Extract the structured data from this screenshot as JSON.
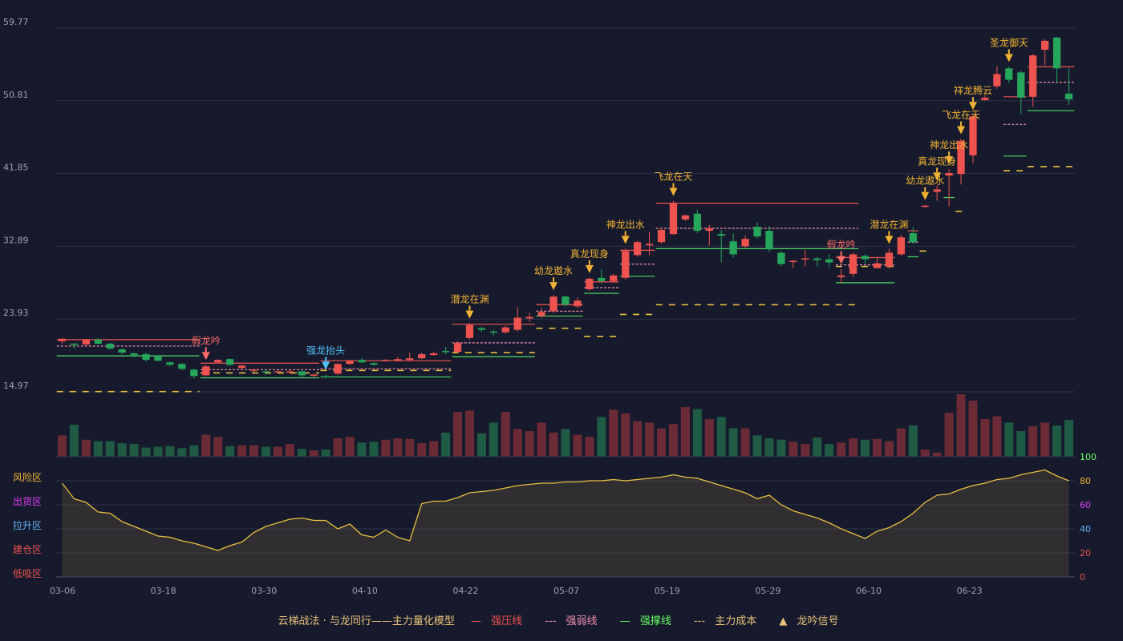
{
  "chart_data": {
    "type": "candlestick",
    "x_ticks": [
      "03-06",
      "03-18",
      "03-30",
      "04-10",
      "04-22",
      "05-07",
      "05-19",
      "05-29",
      "06-10",
      "06-23"
    ],
    "y_ticks": [
      "14.97",
      "23.93",
      "32.89",
      "41.85",
      "50.81",
      "59.77"
    ],
    "ylim": [
      14.97,
      59.77
    ],
    "candles": [
      [
        21.2,
        21.5,
        20.9,
        21.6
      ],
      [
        20.9,
        20.8,
        20.3,
        21.0
      ],
      [
        20.8,
        21.4,
        20.7,
        21.5
      ],
      [
        21.4,
        20.9,
        20.8,
        21.6
      ],
      [
        20.9,
        20.3,
        20.1,
        21.0
      ],
      [
        20.2,
        19.8,
        19.6,
        20.3
      ],
      [
        19.7,
        19.5,
        19.2,
        19.8
      ],
      [
        19.6,
        18.9,
        18.7,
        19.8
      ],
      [
        19.3,
        18.8,
        18.7,
        19.4
      ],
      [
        18.6,
        18.3,
        18.1,
        18.7
      ],
      [
        18.4,
        17.8,
        17.6,
        18.5
      ],
      [
        17.7,
        16.9,
        16.6,
        17.8
      ],
      [
        17.0,
        18.1,
        16.9,
        18.3
      ],
      [
        18.6,
        18.9,
        18.5,
        19.0
      ],
      [
        19.0,
        18.3,
        18.1,
        19.1
      ],
      [
        17.9,
        18.2,
        17.7,
        18.3
      ],
      [
        17.6,
        17.7,
        17.4,
        17.8
      ],
      [
        17.5,
        17.4,
        17.1,
        17.6
      ],
      [
        17.5,
        17.5,
        17.3,
        17.6
      ],
      [
        17.5,
        17.5,
        17.2,
        17.7
      ],
      [
        17.5,
        17.0,
        16.8,
        17.6
      ],
      [
        17.0,
        17.1,
        16.8,
        17.2
      ],
      [
        16.9,
        16.8,
        16.6,
        17.1
      ],
      [
        17.2,
        18.4,
        17.1,
        18.5
      ],
      [
        18.4,
        18.8,
        18.3,
        18.9
      ],
      [
        18.9,
        18.6,
        18.5,
        19.1
      ],
      [
        18.5,
        18.3,
        18.2,
        18.6
      ],
      [
        18.8,
        18.9,
        18.7,
        19.0
      ],
      [
        18.8,
        19.0,
        18.7,
        19.3
      ],
      [
        18.9,
        19.1,
        18.7,
        19.8
      ],
      [
        19.1,
        19.6,
        19.0,
        19.8
      ],
      [
        19.5,
        19.7,
        19.4,
        19.9
      ],
      [
        20.0,
        19.9,
        19.6,
        20.5
      ],
      [
        19.9,
        21.0,
        19.8,
        21.2
      ],
      [
        21.6,
        23.2,
        21.4,
        23.4
      ],
      [
        22.8,
        22.6,
        22.3,
        23.0
      ],
      [
        22.4,
        22.3,
        21.9,
        22.6
      ],
      [
        22.3,
        22.9,
        22.1,
        23.1
      ],
      [
        22.6,
        24.1,
        22.4,
        25.4
      ],
      [
        24.0,
        24.2,
        23.6,
        24.7
      ],
      [
        24.3,
        24.8,
        24.1,
        25.3
      ],
      [
        24.9,
        26.7,
        24.7,
        26.9
      ],
      [
        26.7,
        25.7,
        25.5,
        26.8
      ],
      [
        25.5,
        26.2,
        25.3,
        26.6
      ],
      [
        27.6,
        28.9,
        27.4,
        29.0
      ],
      [
        29.0,
        28.6,
        28.3,
        30.1
      ],
      [
        28.6,
        29.3,
        28.5,
        29.5
      ],
      [
        29.0,
        32.3,
        28.8,
        32.6
      ],
      [
        31.8,
        33.4,
        31.6,
        33.6
      ],
      [
        33.0,
        33.2,
        31.8,
        34.7
      ],
      [
        33.4,
        34.9,
        33.2,
        35.1
      ],
      [
        34.4,
        38.2,
        34.3,
        38.5
      ],
      [
        36.2,
        36.7,
        36.0,
        36.8
      ],
      [
        36.9,
        34.8,
        34.5,
        37.4
      ],
      [
        34.8,
        35.1,
        33.0,
        35.5
      ],
      [
        34.4,
        34.2,
        30.9,
        34.9
      ],
      [
        33.5,
        31.9,
        31.5,
        34.5
      ],
      [
        32.9,
        33.8,
        32.7,
        34.2
      ],
      [
        35.3,
        34.1,
        33.9,
        35.8
      ],
      [
        34.8,
        32.5,
        32.2,
        35.4
      ],
      [
        32.1,
        30.7,
        30.4,
        32.3
      ],
      [
        31.0,
        31.1,
        30.2,
        31.2
      ],
      [
        31.3,
        31.4,
        30.4,
        32.4
      ],
      [
        31.4,
        31.2,
        30.4,
        31.6
      ],
      [
        31.3,
        30.9,
        30.3,
        31.9
      ],
      [
        29.1,
        29.3,
        28.3,
        30.1
      ],
      [
        29.5,
        31.9,
        29.1,
        32.1
      ],
      [
        31.7,
        31.3,
        30.7,
        31.9
      ],
      [
        30.2,
        30.8,
        30.2,
        31.4
      ],
      [
        30.4,
        32.1,
        30.1,
        32.6
      ],
      [
        31.9,
        34.0,
        31.7,
        34.3
      ],
      [
        34.5,
        33.4,
        33.2,
        35.3
      ],
      [
        37.8,
        37.9,
        37.6,
        38.0
      ],
      [
        39.6,
        39.9,
        38.5,
        40.4
      ],
      [
        41.6,
        41.9,
        37.8,
        42.4
      ],
      [
        41.8,
        45.9,
        40.5,
        46.1
      ],
      [
        44.1,
        48.9,
        43.1,
        49.1
      ],
      [
        50.9,
        51.2,
        50.8,
        51.5
      ],
      [
        52.6,
        54.1,
        52.3,
        55.1
      ],
      [
        54.8,
        53.4,
        53.0,
        55.0
      ],
      [
        54.3,
        51.2,
        49.2,
        54.5
      ],
      [
        51.3,
        56.4,
        50.1,
        56.6
      ],
      [
        57.1,
        58.2,
        55.2,
        58.4
      ],
      [
        58.6,
        54.8,
        53.1,
        58.7
      ],
      [
        51.7,
        51.0,
        50.3,
        54.8
      ]
    ],
    "volumes": [
      30,
      45,
      24,
      22,
      22,
      19,
      18,
      13,
      14,
      15,
      12,
      16,
      31,
      28,
      15,
      16,
      16,
      14,
      14,
      18,
      11,
      9,
      10,
      26,
      28,
      20,
      21,
      24,
      26,
      25,
      19,
      22,
      34,
      63,
      65,
      33,
      48,
      63,
      39,
      36,
      48,
      34,
      39,
      31,
      28,
      56,
      66,
      61,
      50,
      48,
      40,
      46,
      70,
      67,
      53,
      56,
      40,
      40,
      30,
      26,
      24,
      21,
      18,
      27,
      18,
      20,
      26,
      24,
      25,
      22,
      40,
      44,
      10,
      6,
      62,
      88,
      79,
      53,
      57,
      48,
      36,
      43,
      48,
      44,
      52
    ],
    "indicator": [
      78,
      65,
      62,
      54,
      53,
      46,
      42,
      38,
      34,
      33,
      30,
      28,
      25,
      22,
      26,
      29,
      37,
      42,
      45,
      48,
      49,
      47,
      47,
      40,
      44,
      35,
      33,
      39,
      33,
      30,
      61,
      63,
      63,
      66,
      70,
      71,
      72,
      74,
      76,
      77,
      78,
      78,
      79,
      79,
      80,
      80,
      81,
      80,
      81,
      82,
      83,
      85,
      83,
      82,
      79,
      76,
      73,
      70,
      65,
      68,
      60,
      55,
      52,
      49,
      45,
      40,
      36,
      32,
      38,
      41,
      46,
      53,
      62,
      68,
      69,
      73,
      76,
      78,
      81,
      82,
      85,
      87,
      89,
      84,
      80
    ],
    "indicator_yticks": [
      "0",
      "20",
      "40",
      "60",
      "80",
      "100"
    ],
    "zone_labels": [
      "风险区",
      "出货区",
      "拉升区",
      "建仓区",
      "低吸区"
    ],
    "annotations": [
      {
        "i": 12,
        "text": "假龙吟",
        "kind": "fake"
      },
      {
        "i": 22,
        "text": "强龙抬头",
        "kind": "strong"
      },
      {
        "i": 34,
        "text": "潜龙在渊",
        "kind": "gold"
      },
      {
        "i": 41,
        "text": "幼龙遨水",
        "kind": "gold"
      },
      {
        "i": 44,
        "text": "真龙现身",
        "kind": "gold"
      },
      {
        "i": 47,
        "text": "神龙出水",
        "kind": "gold"
      },
      {
        "i": 51,
        "text": "飞龙在天",
        "kind": "gold"
      },
      {
        "i": 65,
        "text": "假龙吟",
        "kind": "fake"
      },
      {
        "i": 69,
        "text": "潜龙在渊",
        "kind": "gold"
      },
      {
        "i": 72,
        "text": "幼龙遨水",
        "kind": "gold"
      },
      {
        "i": 73,
        "text": "真龙现身",
        "kind": "gold"
      },
      {
        "i": 74,
        "text": "神龙出水",
        "kind": "gold"
      },
      {
        "i": 75,
        "text": "飞龙在天",
        "kind": "gold"
      },
      {
        "i": 76,
        "text": "祥龙腾云",
        "kind": "gold"
      },
      {
        "i": 79,
        "text": "圣龙御天",
        "kind": "gold"
      }
    ],
    "resistance": [
      [
        0,
        11,
        21.4
      ],
      [
        12,
        21,
        18.5
      ],
      [
        22,
        32,
        18.8
      ],
      [
        33,
        39,
        23.3
      ],
      [
        40,
        43,
        25.7
      ],
      [
        44,
        46,
        28.5
      ],
      [
        47,
        49,
        32.4
      ],
      [
        50,
        66,
        38.2
      ],
      [
        65,
        69,
        31.5
      ],
      [
        71,
        71,
        34.8
      ],
      [
        79,
        80,
        51.3
      ],
      [
        81,
        84,
        55.0
      ]
    ],
    "weak": [
      [
        0,
        11,
        20.6
      ],
      [
        12,
        21,
        17.7
      ],
      [
        22,
        32,
        17.8
      ],
      [
        33,
        39,
        21.0
      ],
      [
        40,
        43,
        24.9
      ],
      [
        44,
        46,
        27.8
      ],
      [
        47,
        49,
        30.7
      ],
      [
        50,
        66,
        35.1
      ],
      [
        65,
        69,
        30.6
      ],
      [
        71,
        71,
        33.4
      ],
      [
        79,
        80,
        47.9
      ],
      [
        81,
        84,
        53.1
      ]
    ],
    "support": [
      [
        0,
        11,
        19.4
      ],
      [
        12,
        21,
        16.7
      ],
      [
        22,
        32,
        16.8
      ],
      [
        33,
        39,
        19.3
      ],
      [
        40,
        43,
        24.3
      ],
      [
        44,
        46,
        27.1
      ],
      [
        47,
        49,
        29.2
      ],
      [
        50,
        66,
        32.6
      ],
      [
        65,
        69,
        28.4
      ],
      [
        71,
        71,
        31.6
      ],
      [
        74,
        74,
        38.9
      ],
      [
        79,
        80,
        44.0
      ],
      [
        81,
        84,
        49.6
      ]
    ],
    "cost": [
      [
        0,
        11,
        15.0
      ],
      [
        12,
        21,
        17.3
      ],
      [
        22,
        32,
        17.6
      ],
      [
        33,
        39,
        19.8
      ],
      [
        40,
        43,
        22.8
      ],
      [
        44,
        46,
        21.8
      ],
      [
        47,
        49,
        24.5
      ],
      [
        50,
        66,
        25.7
      ],
      [
        65,
        69,
        30.4
      ],
      [
        72,
        72,
        32.3
      ],
      [
        75,
        75,
        37.2
      ],
      [
        79,
        80,
        42.2
      ],
      [
        81,
        84,
        42.7
      ]
    ]
  },
  "legend": {
    "model": "云梯战法 · 与龙同行——主力量化模型",
    "strong": "强压线",
    "weak": "强弱线",
    "support": "强撑线",
    "cost": "主力成本",
    "signal": "龙吟信号"
  },
  "colors": {
    "up": "#ef5350",
    "down": "#26a65b",
    "gold": "#f2b233",
    "fake": "#ff6b6b",
    "strong": "#4fc3f7",
    "grid": "#2c3147",
    "axis": "#9aa1b8",
    "bg": "#161a2c"
  }
}
